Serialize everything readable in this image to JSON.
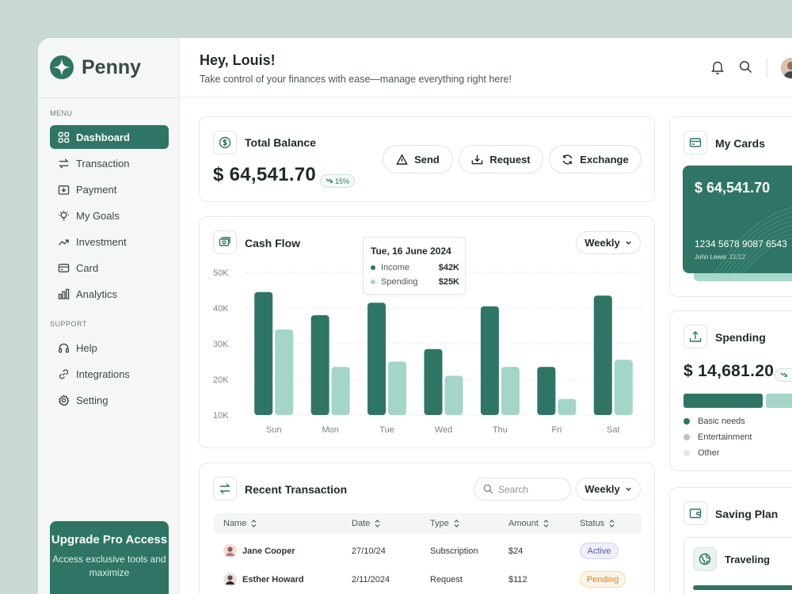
{
  "brand": {
    "name": "Penny"
  },
  "sidebar": {
    "menu_label": "MENU",
    "support_label": "SUPPORT",
    "menu_items": [
      {
        "label": "Dashboard",
        "icon": "grid-icon",
        "active": true
      },
      {
        "label": "Transaction",
        "icon": "transfer-icon"
      },
      {
        "label": "Payment",
        "icon": "payment-icon"
      },
      {
        "label": "My Goals",
        "icon": "bulb-icon"
      },
      {
        "label": "Investment",
        "icon": "trend-up-icon"
      },
      {
        "label": "Card",
        "icon": "card-icon"
      },
      {
        "label": "Analytics",
        "icon": "bar-chart-icon"
      }
    ],
    "support_items": [
      {
        "label": "Help",
        "icon": "headset-icon"
      },
      {
        "label": "Integrations",
        "icon": "link-icon"
      },
      {
        "label": "Setting",
        "icon": "gear-icon"
      }
    ],
    "upgrade": {
      "title": "Upgrade Pro Access",
      "desc": "Access exclusive tools and maximize"
    }
  },
  "header": {
    "greeting": "Hey, Louis!",
    "subtitle": "Take control of your finances with ease—manage everything right here!"
  },
  "balance": {
    "title": "Total Balance",
    "amount": "$ 64,541.70",
    "change": "15%",
    "actions": {
      "send": "Send",
      "request": "Request",
      "exchange": "Exchange"
    }
  },
  "cashflow": {
    "title": "Cash Flow",
    "period": "Weekly",
    "tooltip": {
      "date": "Tue, 16 June 2024",
      "income_label": "Income",
      "income_value": "$42K",
      "spending_label": "Spending",
      "spending_value": "$25K"
    }
  },
  "chart_data": {
    "type": "bar",
    "categories": [
      "Sun",
      "Mon",
      "Tue",
      "Wed",
      "Thu",
      "Fri",
      "Sat"
    ],
    "series": [
      {
        "name": "Income",
        "values": [
          44.5,
          38,
          41.5,
          28.5,
          40.5,
          23.5,
          43.5
        ],
        "color": "#2f7565"
      },
      {
        "name": "Spending",
        "values": [
          34,
          23.5,
          25,
          21,
          23.5,
          14.5,
          25.5
        ],
        "color": "#a3d5c9"
      }
    ],
    "yticks": [
      "50K",
      "40K",
      "30K",
      "20K",
      "10K"
    ],
    "ylim": [
      10,
      50
    ],
    "grid": true
  },
  "transactions": {
    "title": "Recent Transaction",
    "search_placeholder": "Search",
    "period": "Weekly",
    "columns": [
      "Name",
      "Date",
      "Type",
      "Amount",
      "Status"
    ],
    "rows": [
      {
        "name": "Jane Cooper",
        "date": "27/10/24",
        "type": "Subscription",
        "amount": "$24",
        "status": "Active"
      },
      {
        "name": "Esther Howard",
        "date": "2/11/2024",
        "type": "Request",
        "amount": "$112",
        "status": "Pending"
      }
    ]
  },
  "cards": {
    "title": "My Cards",
    "amount": "$ 64,541.70",
    "number": "1234 5678 9087 6543",
    "holder": "John Lewis",
    "expiry": "21/12"
  },
  "spending": {
    "title": "Spending",
    "amount": "$ 14,681.20",
    "legend": [
      {
        "label": "Basic needs",
        "color": "#2f7565"
      },
      {
        "label": "Entertainment",
        "color": "#b9c2c0"
      },
      {
        "label": "Other",
        "color": "#e3e8e6"
      }
    ]
  },
  "saving": {
    "title": "Saving Plan",
    "item": "Traveling"
  }
}
